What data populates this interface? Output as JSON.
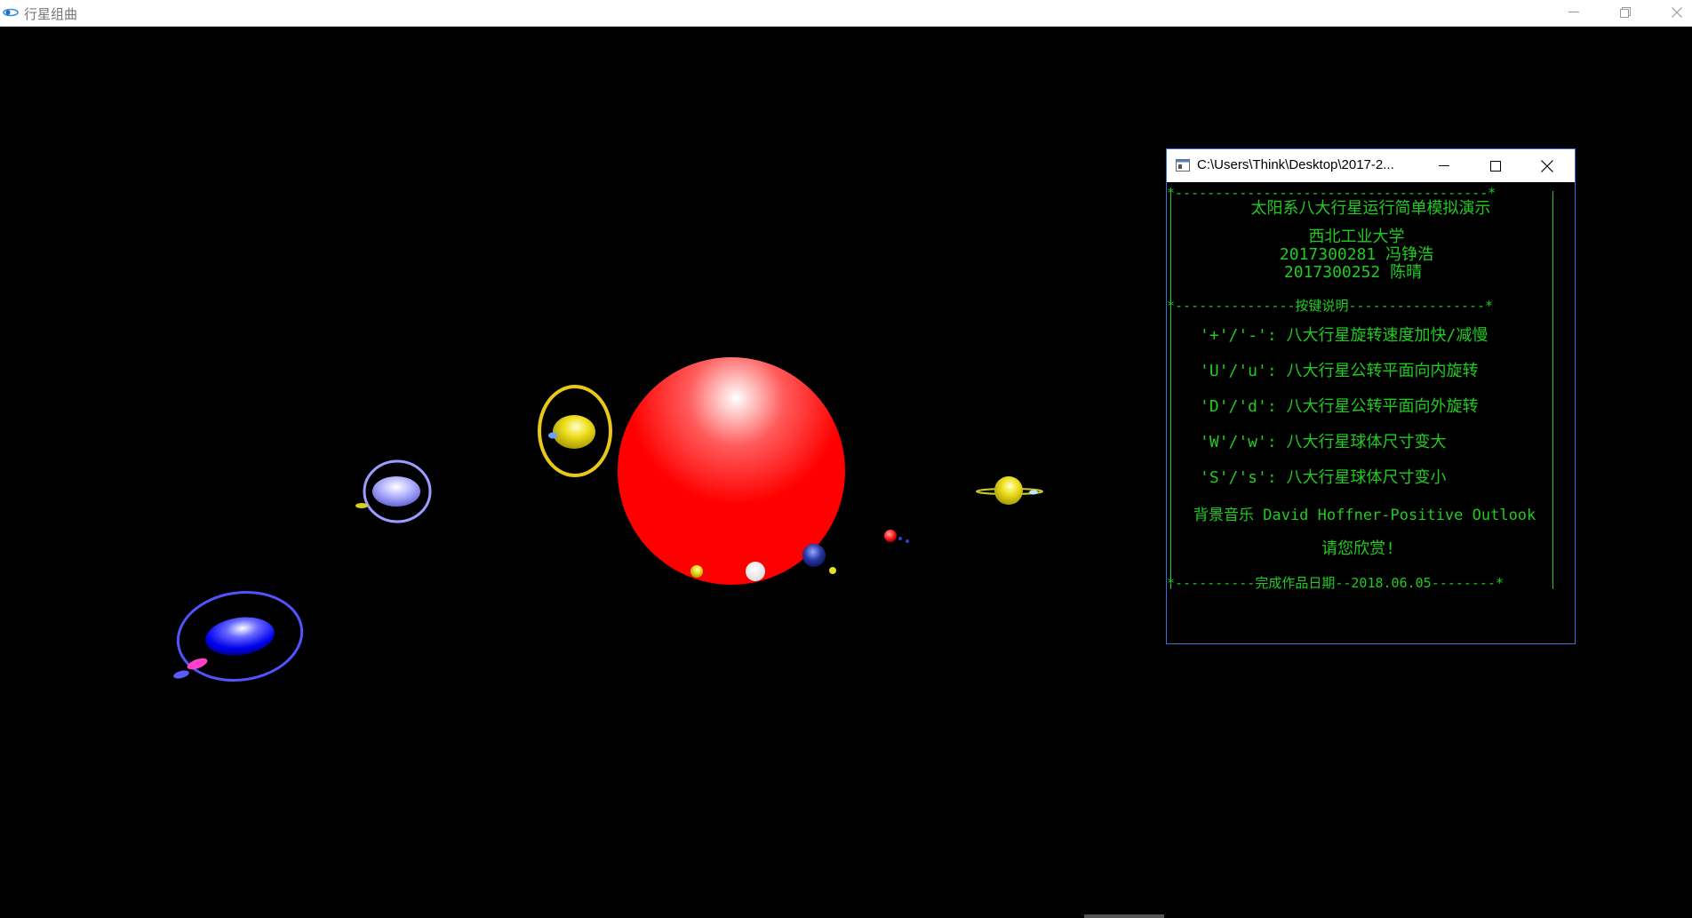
{
  "window": {
    "title": "行星组曲",
    "app_icon": "planet-swoosh-icon"
  },
  "controls": {
    "minimize_icon": "minimize-icon",
    "restore_icon": "restore-icon",
    "close_icon": "close-icon"
  },
  "console": {
    "title": "C:\\Users\\Think\\Desktop\\2017-2...",
    "icon": "console-icon",
    "border_top": "*---------------------------------------*",
    "heading": "太阳系八大行星运行简单模拟演示",
    "school": "西北工业大学",
    "student_1": "2017300281 冯铮浩",
    "student_2": "2017300252 陈晴",
    "keys_header": "*---------------按键说明-----------------*",
    "keys": [
      "'+'/'-': 八大行星旋转速度加快/减慢",
      "'U'/'u': 八大行星公转平面向内旋转",
      "'D'/'d': 八大行星公转平面向外旋转",
      "'W'/'w': 八大行星球体尺寸变大",
      "'S'/'s': 八大行星球体尺寸变小"
    ],
    "music": "背景音乐 David Hoffner-Positive Outlook",
    "enjoy": "请您欣赏!",
    "footer": "*----------完成作品日期--2018.06.05--------*"
  },
  "colors": {
    "background": "#000000",
    "console_text": "#1fcc1f",
    "console_border": "#3a6fd6",
    "sun": "#ff0000"
  }
}
